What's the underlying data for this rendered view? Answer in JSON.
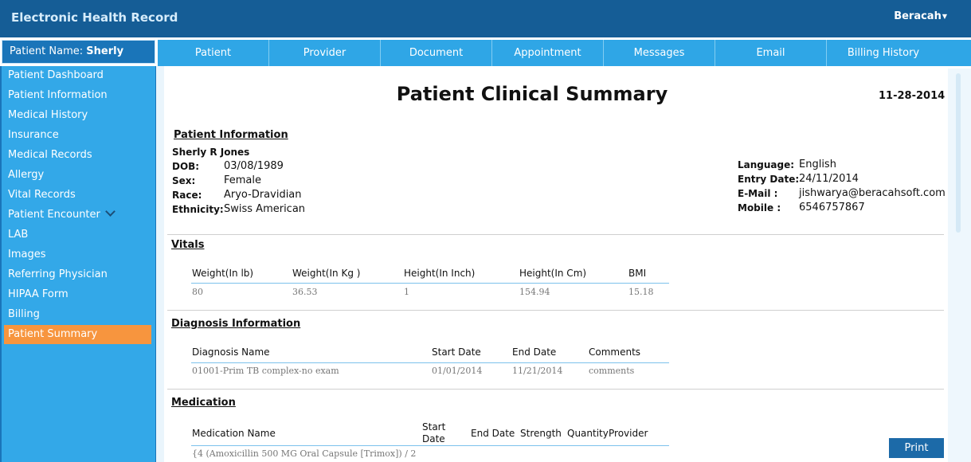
{
  "app": {
    "title": "Electronic Health Record",
    "user": "Beracah"
  },
  "patient_header": {
    "label": "Patient Name:",
    "name": "Sherly"
  },
  "tabs": [
    "Patient",
    "Provider",
    "Document",
    "Appointment",
    "Messages",
    "Email",
    "Billing History"
  ],
  "sidebar": {
    "items": [
      "Patient Dashboard",
      "Patient Information",
      "Medical History",
      "Insurance",
      "Medical Records",
      "Allergy",
      "Vital Records",
      "Patient Encounter",
      "LAB",
      "Images",
      "Referring Physician",
      "HIPAA Form",
      "Billing",
      "Patient Summary"
    ],
    "active": "Patient Summary"
  },
  "summary": {
    "title": "Patient Clinical Summary",
    "date": "11-28-2014",
    "patient_info": {
      "heading": "Patient Information",
      "full_name": "Sherly R Jones",
      "dob_label": "DOB:",
      "dob": "03/08/1989",
      "sex_label": "Sex:",
      "sex": "Female",
      "race_label": "Race:",
      "race": "Aryo-Dravidian",
      "ethnicity_label": "Ethnicity:",
      "ethnicity": "Swiss American",
      "language_label": "Language:",
      "language": "English",
      "entry_label": "Entry Date:",
      "entry_date": "24/11/2014",
      "email_label": "E-Mail :",
      "email": "jishwarya@beracahsoft.com",
      "mobile_label": "Mobile :",
      "mobile": "6546757867"
    },
    "vitals": {
      "heading": "Vitals",
      "columns": [
        "Weight(In lb)",
        "Weight(In Kg )",
        "Height(In Inch)",
        "Height(In Cm)",
        "BMI"
      ],
      "row": [
        "80",
        "36.53",
        "1",
        "154.94",
        "15.18"
      ]
    },
    "diagnosis": {
      "heading": "Diagnosis Information",
      "columns": [
        "Diagnosis Name",
        "Start Date",
        "End Date",
        "Comments"
      ],
      "row": [
        "01001-Prim TB complex-no exam",
        "01/01/2014",
        "11/21/2014",
        "comments"
      ]
    },
    "medication": {
      "heading": "Medication",
      "col_name": "Medication Name",
      "col_start_1": "Start",
      "col_start_2": "Date",
      "col_end": "End Date",
      "col_strength": "Strength",
      "col_qty": "Quantity",
      "col_provider": "Provider",
      "row_name": "{4 (Amoxicillin 500 MG Oral Capsule [Trimox]) / 2"
    }
  },
  "print_label": "Print"
}
